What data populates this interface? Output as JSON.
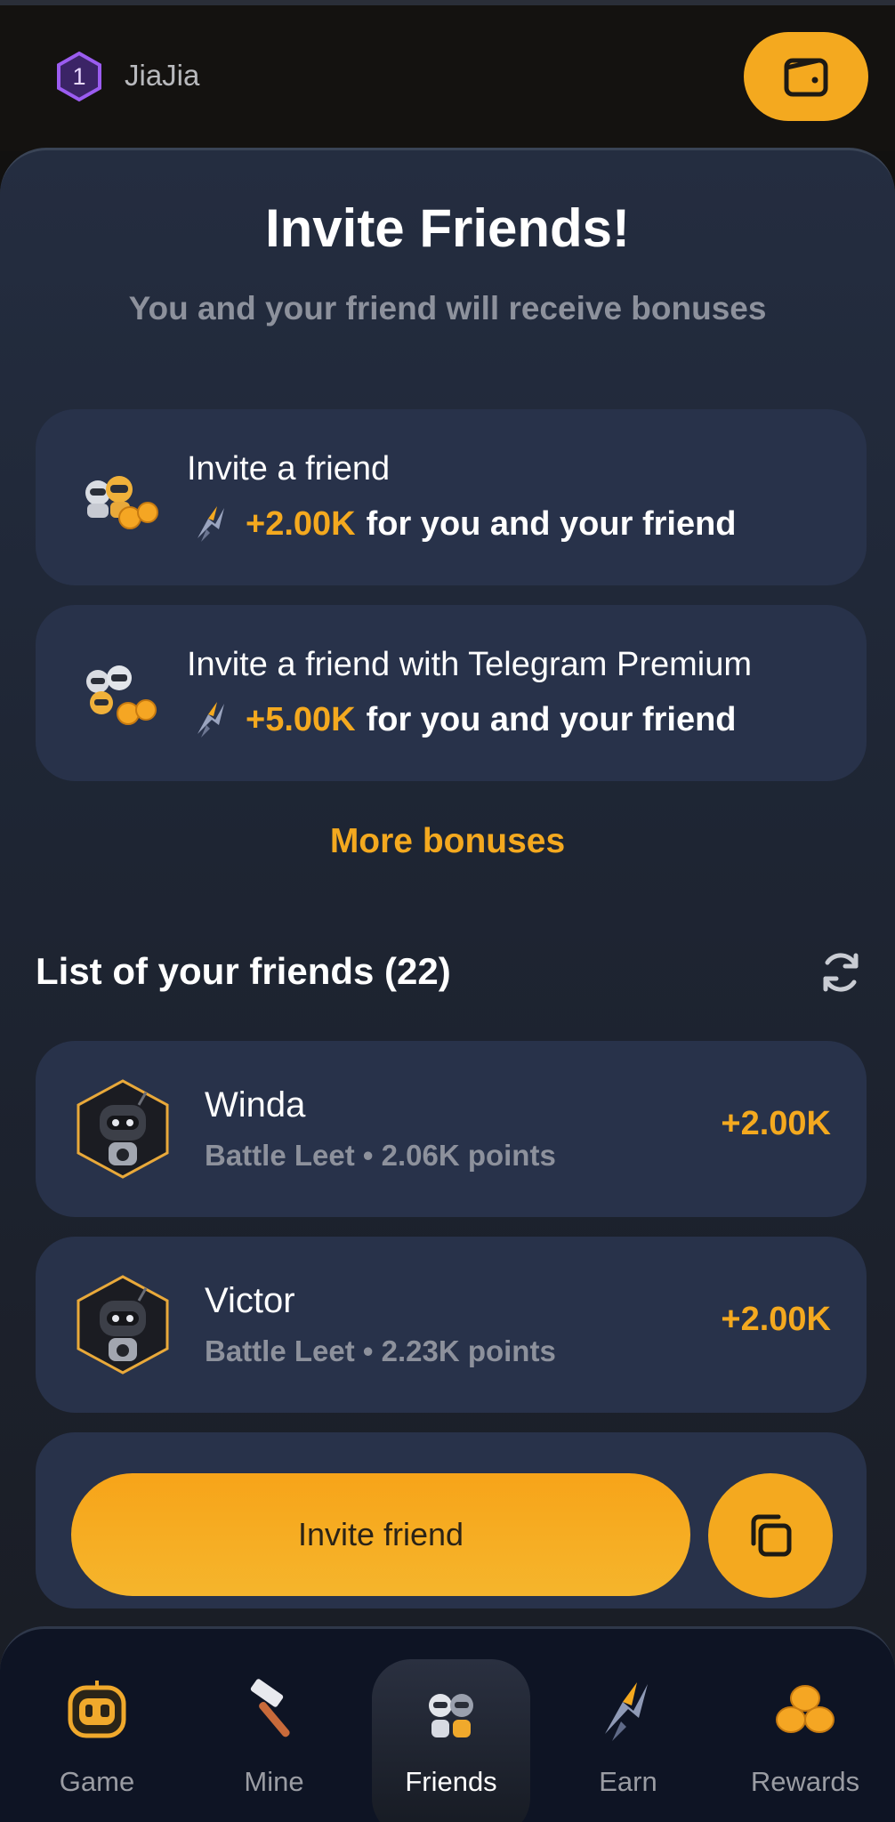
{
  "header": {
    "level": "1",
    "username": "JiaJia"
  },
  "invite": {
    "title": "Invite Friends!",
    "subtitle": "You and your friend will receive bonuses",
    "cards": [
      {
        "title": "Invite a friend",
        "amount": "+2.00K",
        "text": "for you and your friend"
      },
      {
        "title": "Invite a friend with Telegram Premium",
        "amount": "+5.00K",
        "text": "for you and your friend"
      }
    ],
    "more_bonuses": "More bonuses"
  },
  "friends": {
    "list_title": "List of your friends (22)",
    "items": [
      {
        "name": "Winda",
        "meta": "Battle Leet • 2.06K points",
        "reward": "+2.00K"
      },
      {
        "name": "Victor",
        "meta": "Battle Leet • 2.23K points",
        "reward": "+2.00K"
      }
    ]
  },
  "actions": {
    "invite_label": "Invite friend"
  },
  "nav": {
    "items": [
      {
        "label": "Game",
        "icon": "game-icon"
      },
      {
        "label": "Mine",
        "icon": "hammer-icon"
      },
      {
        "label": "Friends",
        "icon": "robots-icon",
        "active": true
      },
      {
        "label": "Earn",
        "icon": "bolt-icon"
      },
      {
        "label": "Rewards",
        "icon": "coins-icon"
      }
    ]
  },
  "colors": {
    "accent": "#f4a91f",
    "card": "#28324a",
    "background": "#121110"
  }
}
